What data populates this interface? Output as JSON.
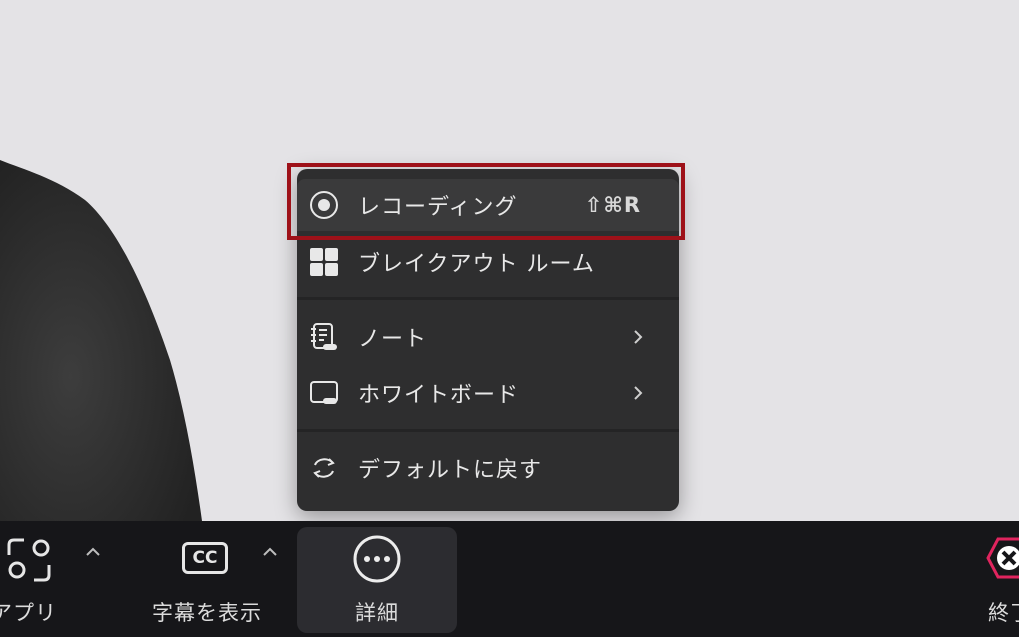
{
  "menu": {
    "items": [
      {
        "label": "レコーディング",
        "shortcut": "⇧⌘R",
        "icon": "record-icon"
      },
      {
        "label": "ブレイクアウト ルーム",
        "icon": "grid-icon"
      },
      {
        "label": "ノート",
        "icon": "notes-icon",
        "submenu": true
      },
      {
        "label": "ホワイトボード",
        "icon": "whiteboard-icon",
        "submenu": true
      },
      {
        "label": "デフォルトに戻す",
        "icon": "reset-icon"
      }
    ]
  },
  "toolbar": {
    "apps_label": "アプリ",
    "captions_label": "字幕を表示",
    "captions_badge": "CC",
    "more_label": "詳細",
    "end_label": "終了"
  },
  "colors": {
    "highlight": "#9e1119",
    "end_button": "#e0245e",
    "menu_bg": "#2e2e2f",
    "toolbar_bg": "#161619"
  }
}
